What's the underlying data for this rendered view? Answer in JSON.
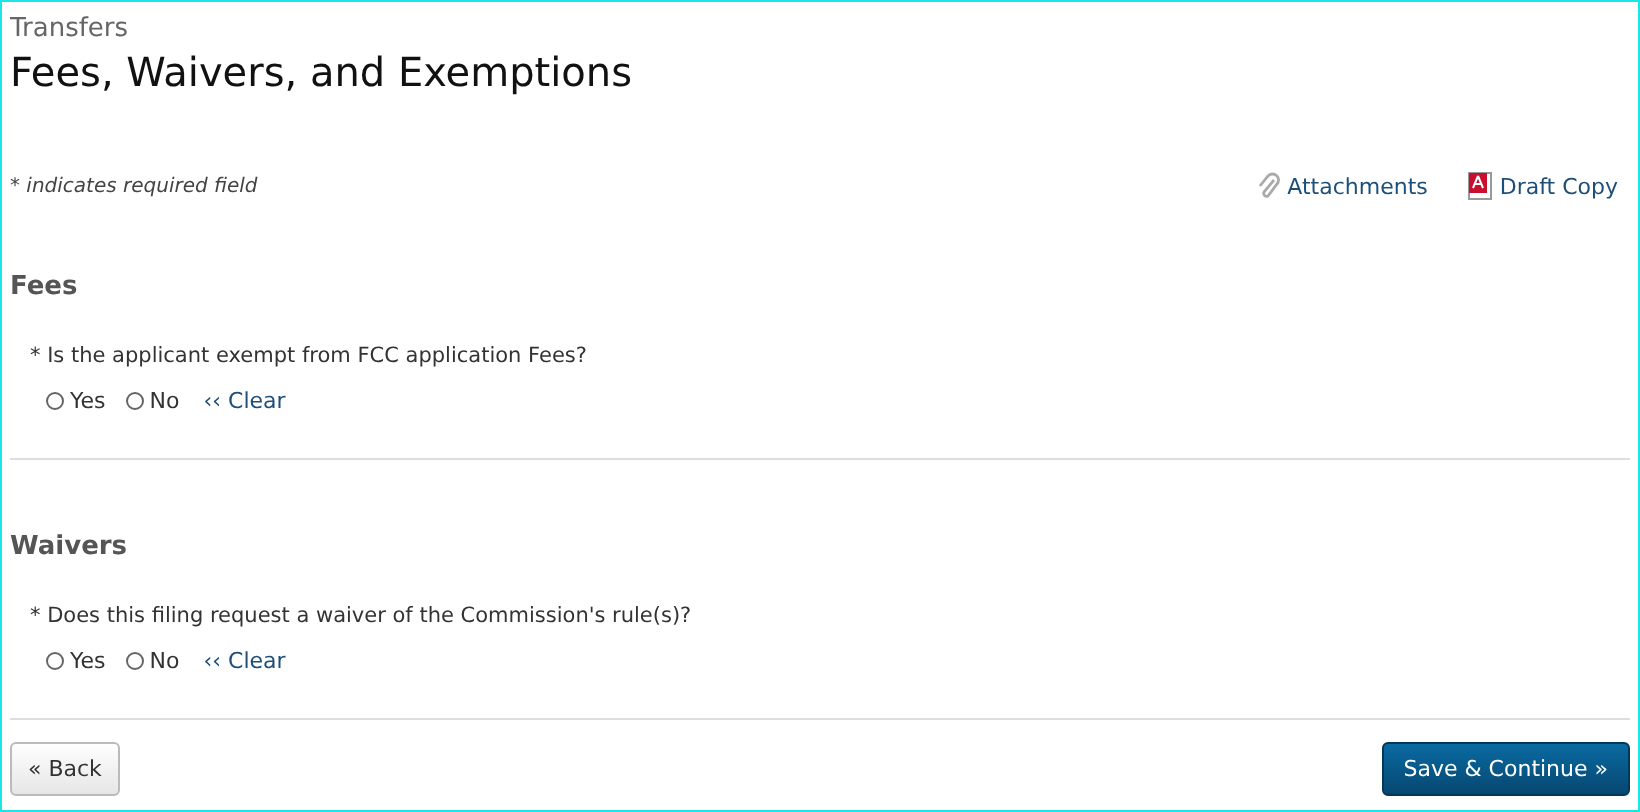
{
  "breadcrumb": "Transfers",
  "title": "Fees, Waivers, and Exemptions",
  "required_note": "* indicates required field",
  "links": [
    {
      "kind": "attachments",
      "label": "Attachments"
    },
    {
      "kind": "pdf",
      "label": "Draft Copy"
    }
  ],
  "sections": [
    {
      "heading": "Fees",
      "question": "* Is the applicant exempt from FCC application Fees?",
      "options": [
        {
          "label": "Yes",
          "selected": false
        },
        {
          "label": "No",
          "selected": false
        }
      ],
      "clear": "‹‹ Clear"
    },
    {
      "heading": "Waivers",
      "question": "* Does this filing request a waiver of the Commission's rule(s)?",
      "options": [
        {
          "label": "Yes",
          "selected": false
        },
        {
          "label": "No",
          "selected": false
        }
      ],
      "clear": "‹‹ Clear"
    }
  ],
  "buttons": {
    "back": "« Back",
    "next": "Save & Continue »"
  }
}
